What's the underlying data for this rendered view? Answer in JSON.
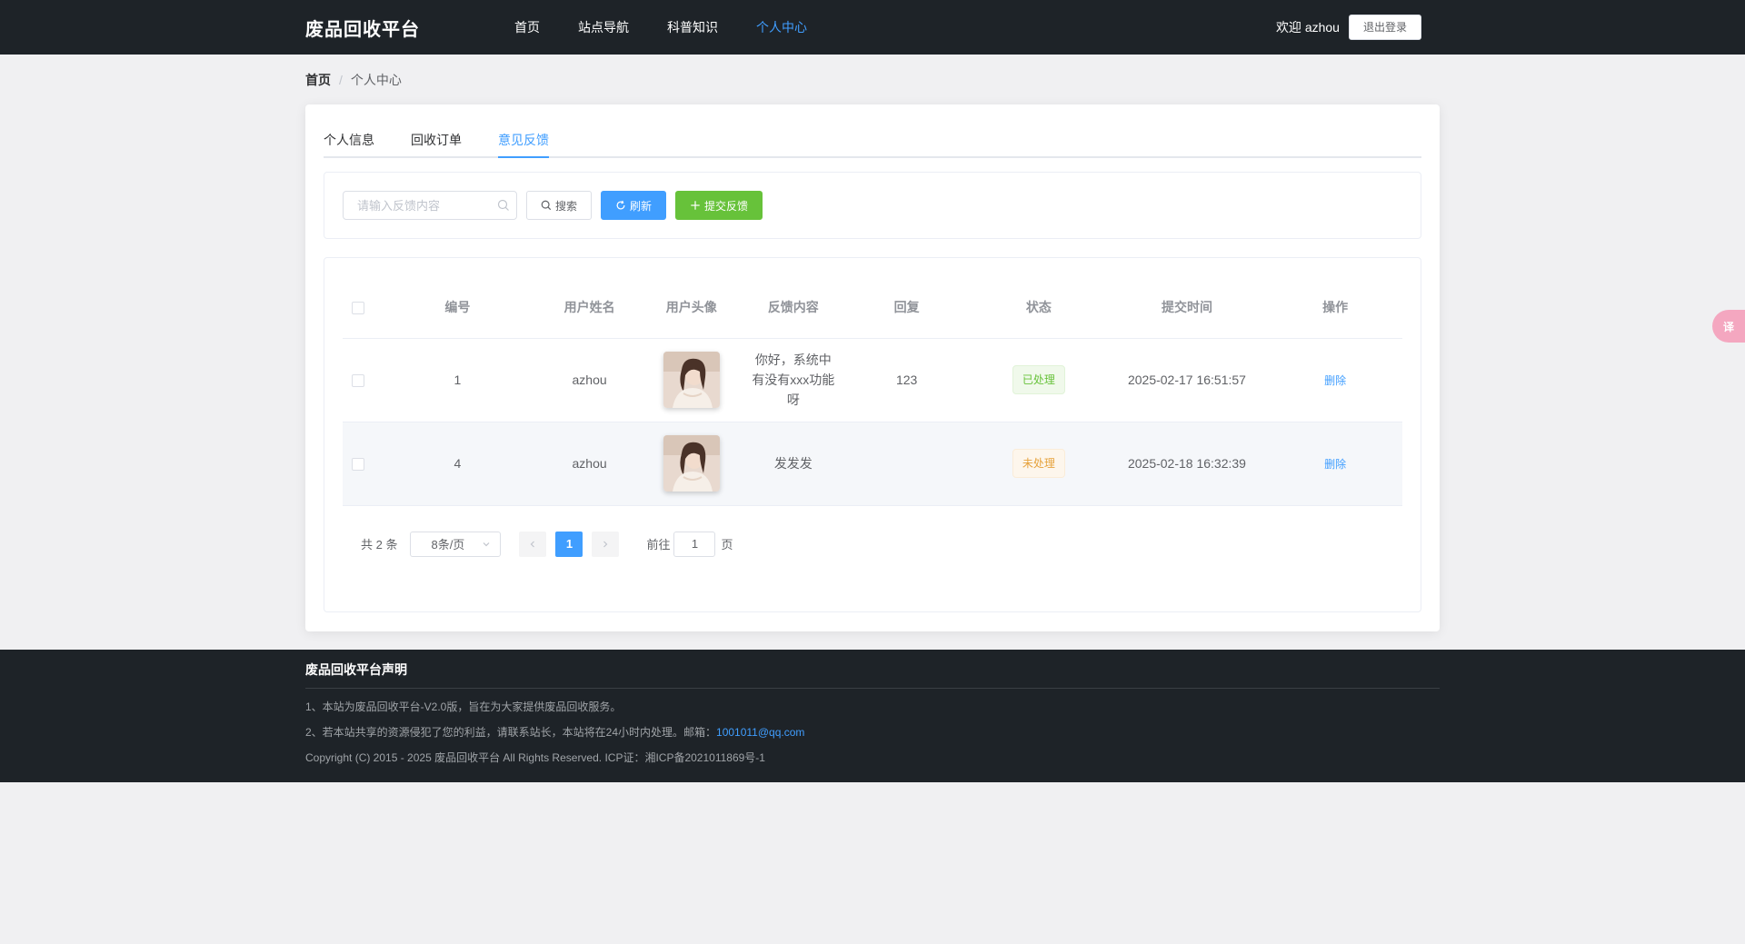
{
  "header": {
    "brand": "废品回收平台",
    "nav": [
      "首页",
      "站点导航",
      "科普知识",
      "个人中心"
    ],
    "welcome": "欢迎 azhou",
    "logout": "退出登录"
  },
  "breadcrumb": {
    "home": "首页",
    "separator": "/",
    "current": "个人中心"
  },
  "tabs": [
    "个人信息",
    "回收订单",
    "意见反馈"
  ],
  "toolbar": {
    "search_placeholder": "请输入反馈内容",
    "search_btn": "搜索",
    "refresh_btn": "刷新",
    "submit_btn": "提交反馈"
  },
  "table": {
    "columns": [
      "编号",
      "用户姓名",
      "用户头像",
      "反馈内容",
      "回复",
      "状态",
      "提交时间",
      "操作"
    ],
    "rows": [
      {
        "id": "1",
        "name": "azhou",
        "content": "你好，系统中有没有xxx功能呀",
        "reply": "123",
        "status": "已处理",
        "time": "2025-02-17 16:51:57",
        "action": "删除"
      },
      {
        "id": "4",
        "name": "azhou",
        "content": "发发发",
        "reply": "",
        "status": "未处理",
        "time": "2025-02-18 16:32:39",
        "action": "删除"
      }
    ]
  },
  "pagination": {
    "total": "共 2 条",
    "page_size": "8条/页",
    "current": "1",
    "goto_label": "前往",
    "goto_value": "1",
    "goto_suffix": "页"
  },
  "footer": {
    "title": "废品回收平台声明",
    "line1": "1、本站为废品回收平台-V2.0版，旨在为大家提供废品回收服务。",
    "line2_prefix": "2、若本站共享的资源侵犯了您的利益，请联系站长，本站将在24小时内处理。邮箱：",
    "email": "1001011@qq.com",
    "line3": "Copyright (C) 2015 - 2025 废品回收平台 All Rights Reserved. ICP证：湘ICP备2021011869号-1"
  },
  "float_widget": "译",
  "colors": {
    "primary": "#409eff",
    "success": "#67c23a",
    "warning": "#e6a23c",
    "header_bg": "#1e2328"
  }
}
